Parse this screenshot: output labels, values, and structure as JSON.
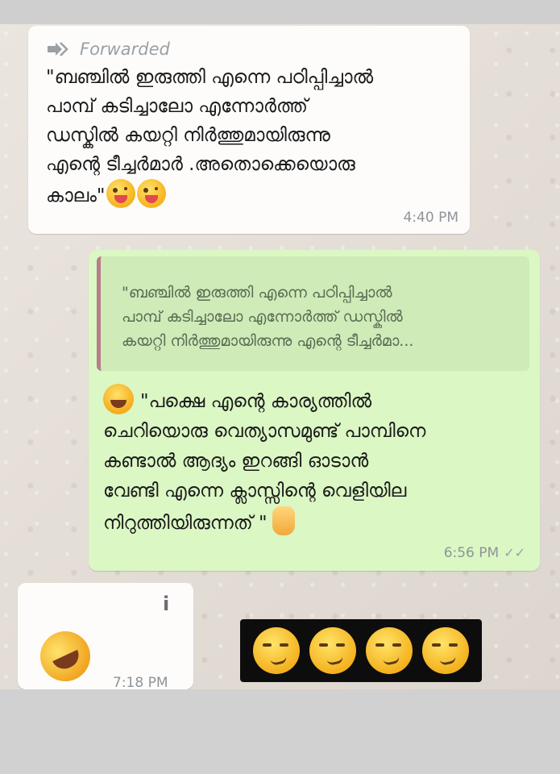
{
  "message_1": {
    "forwarded_label": "Forwarded",
    "text": "\"ബഞ്ചിൽ ഇരുത്തി എന്നെ പഠിപ്പിച്ചാൽ\nപാമ്പ് കടിച്ചാലോ എന്നോർത്ത്\nഡസ്കിൽ കയറ്റി നിർത്തുമായിരുന്നു\nഎന്റെ ടീച്ചർമാർ .അതൊക്കെയൊരു\nകാലം\"",
    "emoji": "winking-face-with-tongue",
    "time": "4:40 PM"
  },
  "message_2": {
    "quote": "\"ബഞ്ചിൽ ഇരുത്തി എന്നെ പഠിപ്പിച്ചാൽ\nപാമ്പ് കടിച്ചാലോ എന്നോർത്ത് ഡസ്കിൽ\nകയറ്റി നിർത്തുമായിരുന്നു എന്റെ ടീച്ചർമാ...",
    "text": "\"പക്ഷെ എന്റെ കാര്യത്തിൽ\nചെറിയൊരു വെത്യാസമുണ്ട് പാമ്പിനെ\nകണ്ടാൽ ആദ്യം ഇറങ്ങി ഓടാൻ\nവേണ്ടി എന്നെ ക്ലാസ്സിന്റെ വെളിയില\nനിറുത്തിയിരുന്നത് \"",
    "time": "6:56 PM",
    "ticks": "✓✓"
  },
  "message_3": {
    "info_label": "i",
    "emoji": "rolling-on-floor-laughing",
    "time": "7:18 PM"
  },
  "reaction_emojis": [
    "smirking-face",
    "smirking-face",
    "smirking-face",
    "smirking-face"
  ]
}
